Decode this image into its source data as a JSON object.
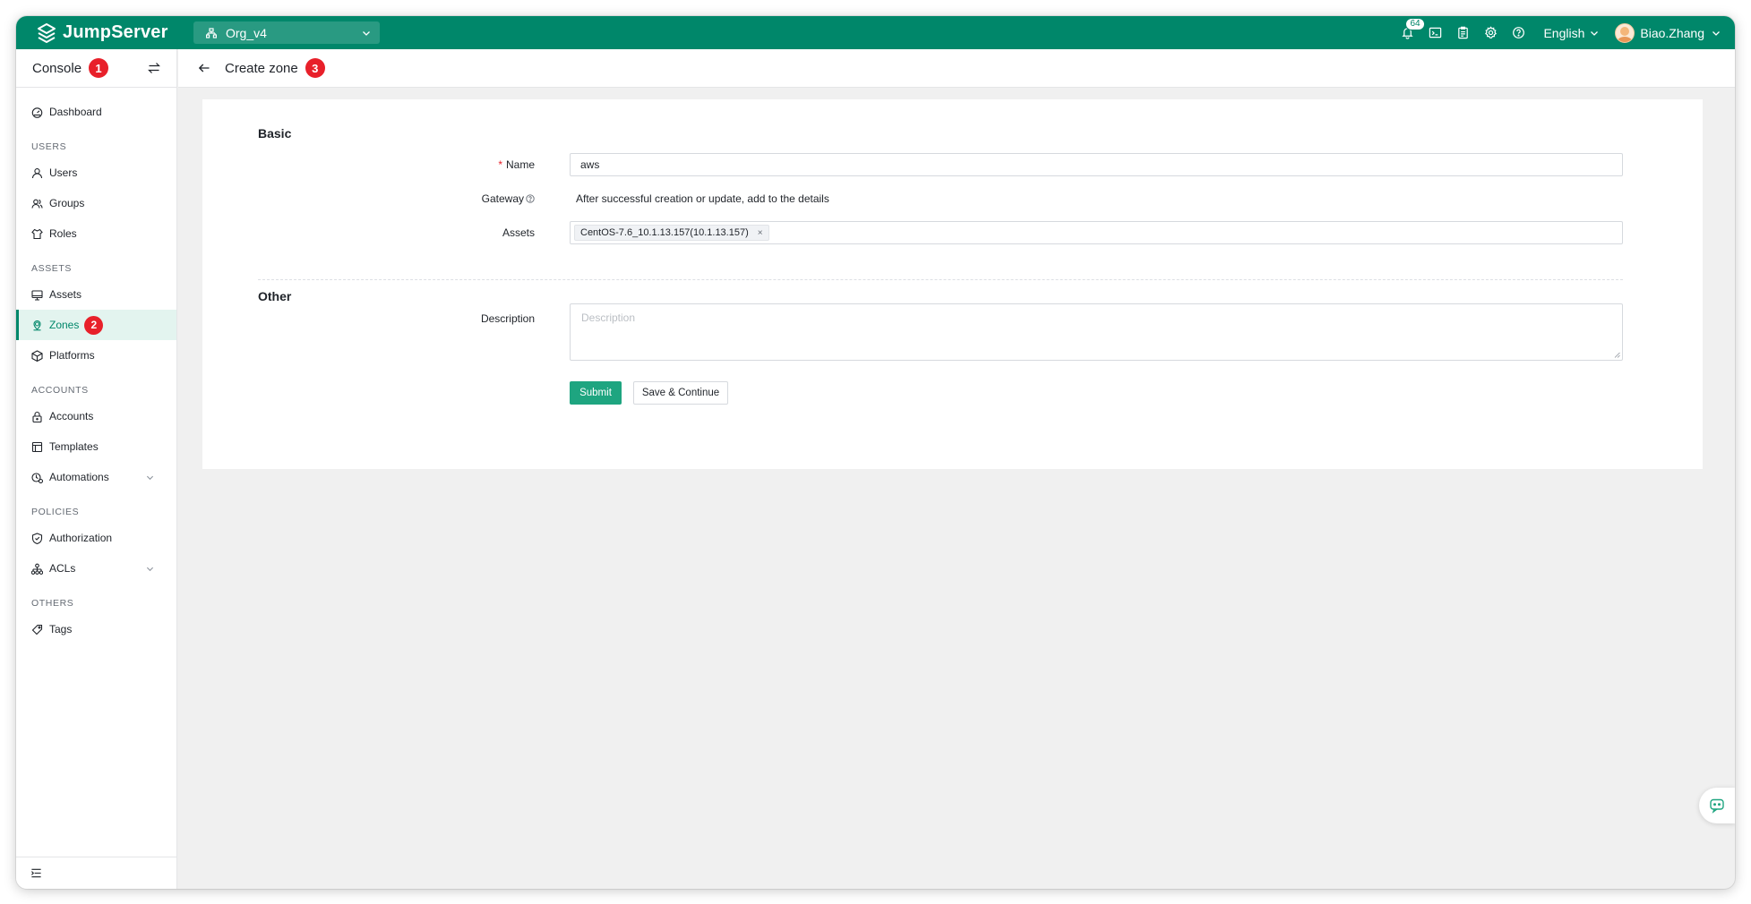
{
  "app": {
    "name": "JumpServer",
    "org": "Org_v4",
    "notification_count": "64",
    "language": "English",
    "user": "Biao.Zhang",
    "accent_color": "#00876a"
  },
  "sidebar": {
    "title": "Console",
    "title_step": "1",
    "items": [
      {
        "type": "item",
        "label": "Dashboard",
        "icon": "dashboard-icon"
      },
      {
        "type": "group",
        "label": "USERS"
      },
      {
        "type": "item",
        "label": "Users",
        "icon": "user-icon"
      },
      {
        "type": "item",
        "label": "Groups",
        "icon": "group-icon"
      },
      {
        "type": "item",
        "label": "Roles",
        "icon": "role-icon"
      },
      {
        "type": "group",
        "label": "ASSETS"
      },
      {
        "type": "item",
        "label": "Assets",
        "icon": "monitor-icon"
      },
      {
        "type": "item",
        "label": "Zones",
        "icon": "zone-icon",
        "active": true,
        "step": "2"
      },
      {
        "type": "item",
        "label": "Platforms",
        "icon": "cube-icon"
      },
      {
        "type": "group",
        "label": "ACCOUNTS"
      },
      {
        "type": "item",
        "label": "Accounts",
        "icon": "lock-icon"
      },
      {
        "type": "item",
        "label": "Templates",
        "icon": "template-icon"
      },
      {
        "type": "item",
        "label": "Automations",
        "icon": "automation-icon",
        "expandable": true
      },
      {
        "type": "group",
        "label": "POLICIES"
      },
      {
        "type": "item",
        "label": "Authorization",
        "icon": "shield-icon"
      },
      {
        "type": "item",
        "label": "ACLs",
        "icon": "acl-icon",
        "expandable": true
      },
      {
        "type": "group",
        "label": "OTHERS"
      },
      {
        "type": "item",
        "label": "Tags",
        "icon": "tag-icon"
      }
    ]
  },
  "page": {
    "title": "Create zone",
    "title_step": "3"
  },
  "form": {
    "basic_title": "Basic",
    "name_label": "Name",
    "name_value": "aws",
    "gateway_label": "Gateway",
    "gateway_text": "After successful creation or update, add to the details",
    "assets_label": "Assets",
    "asset_tag": "CentOS-7.6_10.1.13.157(10.1.13.157)",
    "asset_tag_close": "×",
    "other_title": "Other",
    "description_label": "Description",
    "description_placeholder": "Description",
    "submit_label": "Submit",
    "save_continue_label": "Save & Continue"
  }
}
